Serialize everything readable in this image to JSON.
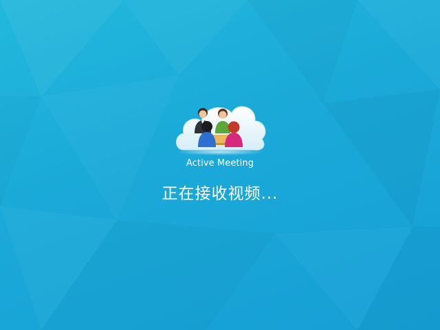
{
  "window": {
    "background_color": "#1aa9d8"
  },
  "splash": {
    "logo_icon": "meeting-cloud-logo-icon",
    "app_name": "Active Meeting",
    "status_text": "正在接收视频..."
  }
}
